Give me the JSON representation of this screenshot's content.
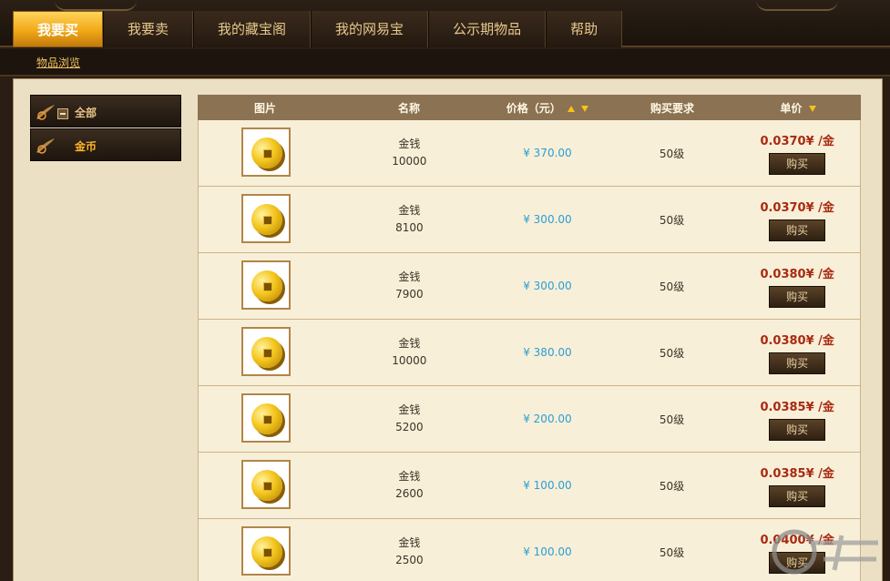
{
  "nav": {
    "tabs": [
      "我要买",
      "我要卖",
      "我的藏宝阁",
      "我的网易宝",
      "公示期物品",
      "帮助"
    ],
    "active_index": 0
  },
  "subnav": {
    "link": "物品浏览"
  },
  "sidebar": {
    "items": [
      {
        "label": "全部",
        "selected": false
      },
      {
        "label": "金币",
        "selected": true
      }
    ]
  },
  "table": {
    "headers": {
      "image": "图片",
      "name": "名称",
      "price": "价格（元）",
      "req": "购买要求",
      "unit": "单价"
    },
    "buy_label": "购买",
    "rows": [
      {
        "name": "金钱",
        "qty": "10000",
        "price": "¥ 370.00",
        "req": "50级",
        "unit": "0.0370¥ /金"
      },
      {
        "name": "金钱",
        "qty": "8100",
        "price": "¥ 300.00",
        "req": "50级",
        "unit": "0.0370¥ /金"
      },
      {
        "name": "金钱",
        "qty": "7900",
        "price": "¥ 300.00",
        "req": "50级",
        "unit": "0.0380¥ /金"
      },
      {
        "name": "金钱",
        "qty": "10000",
        "price": "¥ 380.00",
        "req": "50级",
        "unit": "0.0380¥ /金"
      },
      {
        "name": "金钱",
        "qty": "5200",
        "price": "¥ 200.00",
        "req": "50级",
        "unit": "0.0385¥ /金"
      },
      {
        "name": "金钱",
        "qty": "2600",
        "price": "¥ 100.00",
        "req": "50级",
        "unit": "0.0385¥ /金"
      },
      {
        "name": "金钱",
        "qty": "2500",
        "price": "¥ 100.00",
        "req": "50级",
        "unit": "0.0400¥ /金"
      }
    ]
  },
  "colors": {
    "accent": "#f0a817",
    "price": "#2a9ed6",
    "unit_price": "#a82a12",
    "header_bg": "#8a7252"
  },
  "icons": {
    "coin": "gold-coin-icon",
    "feather": "feather-icon",
    "collapse": "minus-box-icon"
  }
}
